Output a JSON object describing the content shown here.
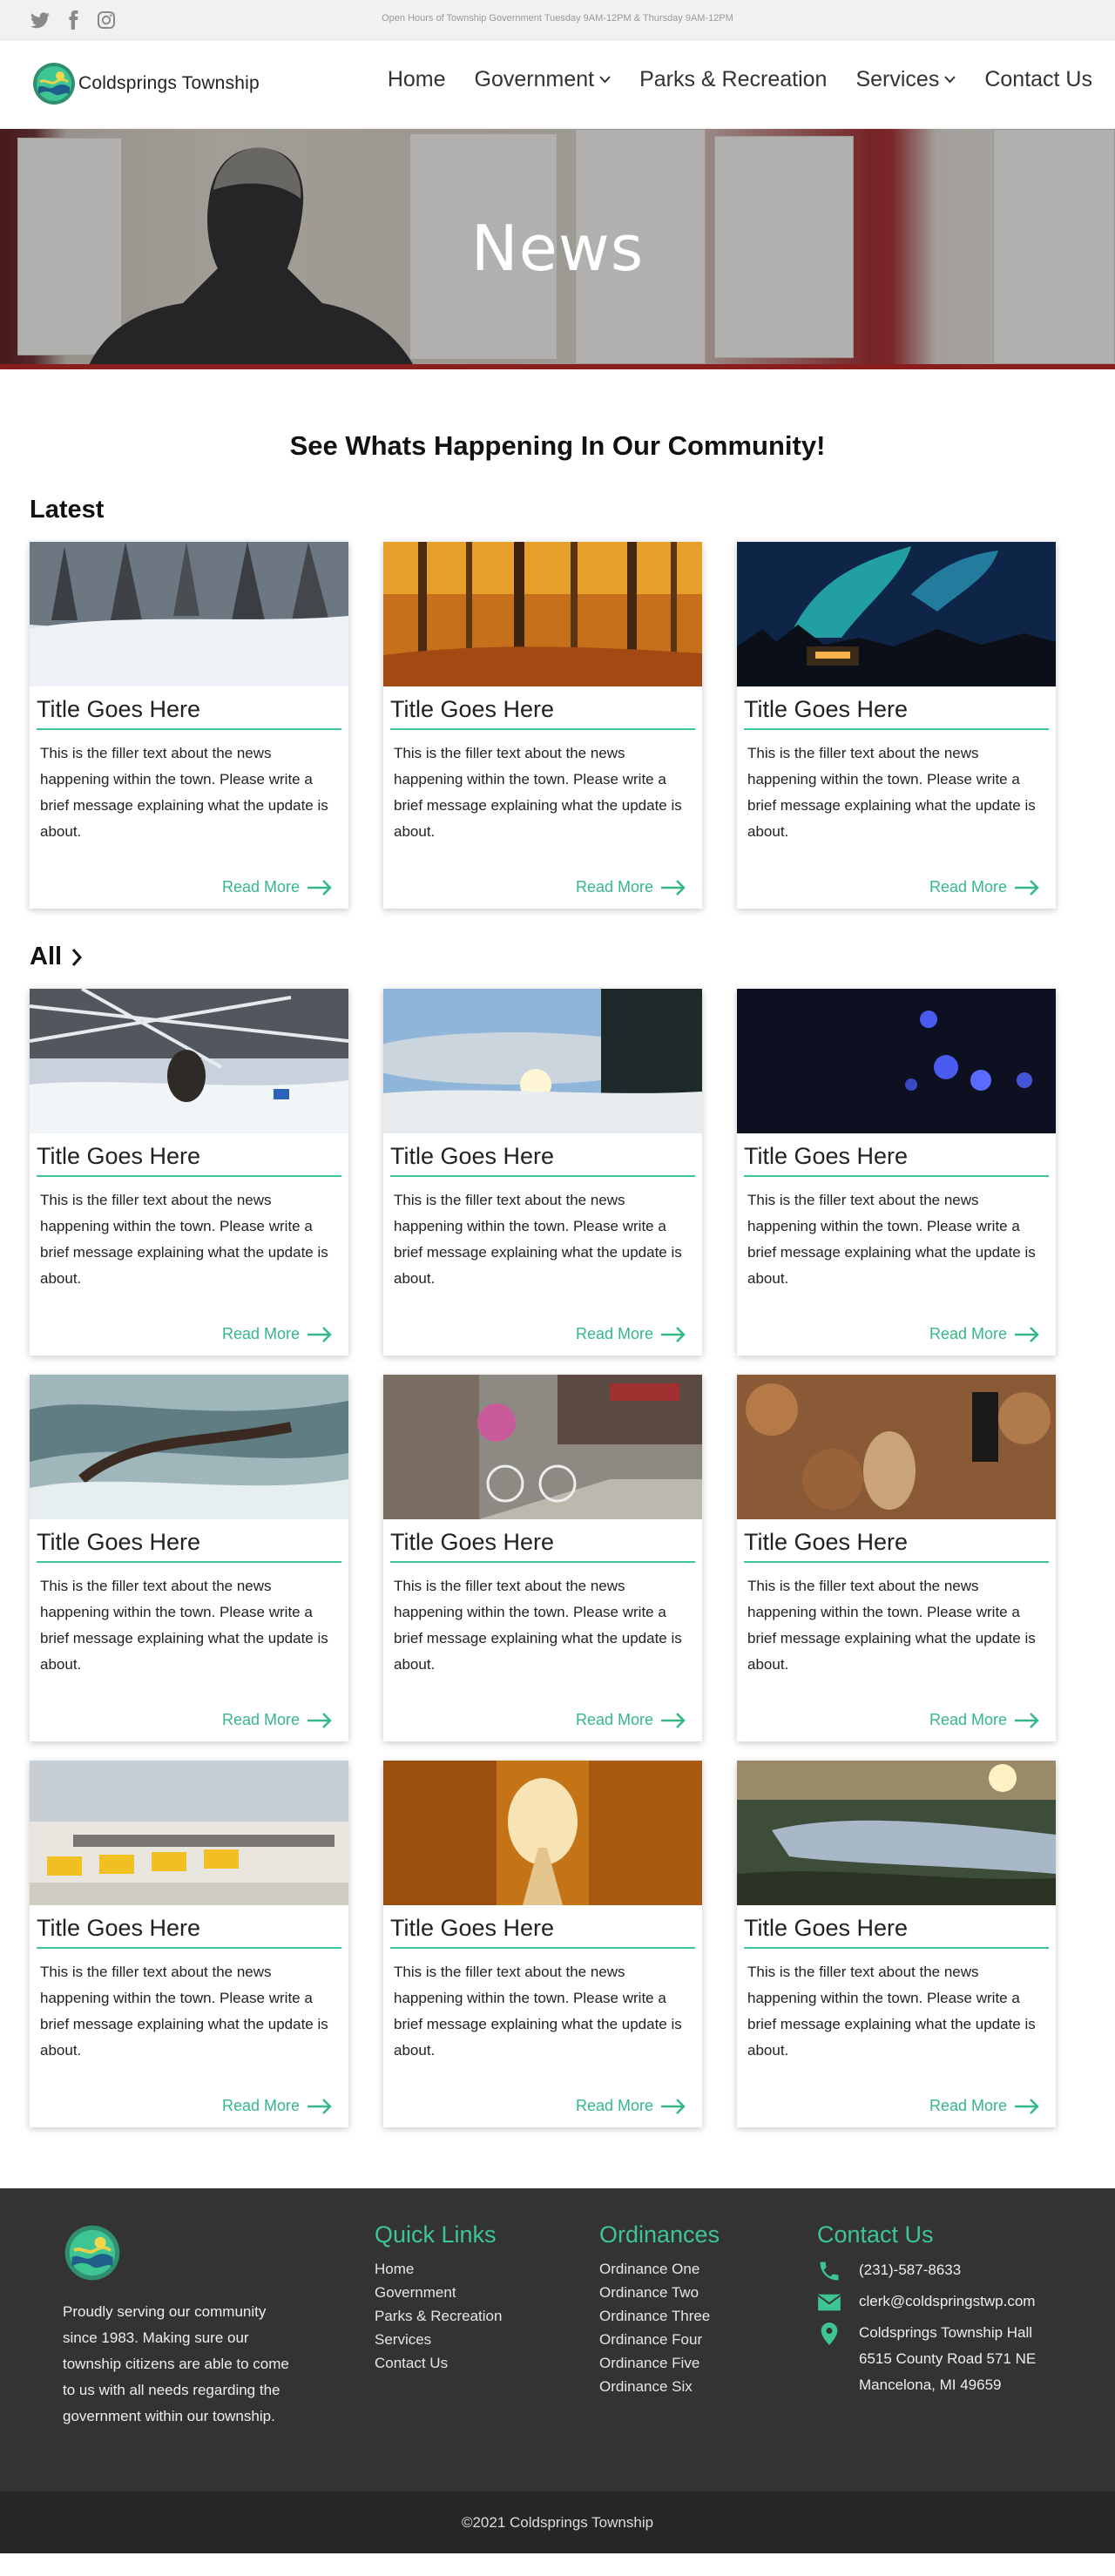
{
  "topbar": {
    "hours": "Open Hours of Township Government Tuesday 9AM-12PM & Thursday 9AM-12PM",
    "social_icons": [
      "twitter-icon",
      "facebook-icon",
      "instagram-icon"
    ]
  },
  "brand": {
    "name": "Coldsprings Township",
    "accent": "#3ec594"
  },
  "nav": {
    "items": [
      {
        "label": "Home"
      },
      {
        "label": "Government"
      },
      {
        "label": "Parks & Recreation"
      },
      {
        "label": "Services"
      },
      {
        "label": "Contact Us"
      }
    ]
  },
  "hero": {
    "title": "News"
  },
  "headline": "See Whats Happening In Our Community!",
  "sections": {
    "latest": "Latest",
    "all": "All"
  },
  "card_defaults": {
    "title": "Title Goes Here",
    "text": "This is the filler text about the news happening within the town. Please write a brief message explaining what the update is about.",
    "read_more": "Read More"
  },
  "latest_cards": [
    {
      "title": "Title Goes Here",
      "text": "This is the filler text about the news happening within the town. Please write a brief message explaining what the update is about.",
      "read_more": "Read More",
      "image": "snowy-forest"
    },
    {
      "title": "Title Goes Here",
      "text": "This is the filler text about the news happening within the town. Please write a brief message explaining what the update is about.",
      "read_more": "Read More",
      "image": "autumn-forest"
    },
    {
      "title": "Title Goes Here",
      "text": "This is the filler text about the news happening within the town. Please write a brief message explaining what the update is about.",
      "read_more": "Read More",
      "image": "northern-lights"
    }
  ],
  "all_cards": [
    {
      "title": "Title Goes Here",
      "text": "This is the filler text about the news happening within the town. Please write a brief message explaining what the update is about.",
      "read_more": "Read More",
      "image": "ice-fishing"
    },
    {
      "title": "Title Goes Here",
      "text": "This is the filler text about the news happening within the town. Please write a brief message explaining what the update is about.",
      "read_more": "Read More",
      "image": "winter-sunset"
    },
    {
      "title": "Title Goes Here",
      "text": "This is the filler text about the news happening within the town. Please write a brief message explaining what the update is about.",
      "read_more": "Read More",
      "image": "jellyfish"
    },
    {
      "title": "Title Goes Here",
      "text": "This is the filler text about the news happening within the town. Please write a brief message explaining what the update is about.",
      "read_more": "Read More",
      "image": "frozen-water"
    },
    {
      "title": "Title Goes Here",
      "text": "This is the filler text about the news happening within the town. Please write a brief message explaining what the update is about.",
      "read_more": "Read More",
      "image": "street-bicycle"
    },
    {
      "title": "Title Goes Here",
      "text": "This is the filler text about the news happening within the town. Please write a brief message explaining what the update is about.",
      "read_more": "Read More",
      "image": "squirrel-leaves"
    },
    {
      "title": "Title Goes Here",
      "text": "This is the filler text about the news happening within the town. Please write a brief message explaining what the update is about.",
      "read_more": "Read More",
      "image": "cafe-chairs"
    },
    {
      "title": "Title Goes Here",
      "text": "This is the filler text about the news happening within the town. Please write a brief message explaining what the update is about.",
      "read_more": "Read More",
      "image": "autumn-road"
    },
    {
      "title": "Title Goes Here",
      "text": "This is the filler text about the news happening within the town. Please write a brief message explaining what the update is about.",
      "read_more": "Read More",
      "image": "lake-sunset"
    }
  ],
  "footer": {
    "about": "Proudly serving our community since 1983. Making sure our township citizens are able to come to us with all needs regarding the government within our township.",
    "quick_links": {
      "title": "Quick Links",
      "items": [
        "Home",
        "Government",
        "Parks & Recreation",
        "Services",
        "Contact Us"
      ]
    },
    "ordinances": {
      "title": "Ordinances",
      "items": [
        "Ordinance One",
        "Ordinance Two",
        "Ordinance Three",
        "Ordinance Four",
        "Ordinance Five",
        "Ordinance Six"
      ]
    },
    "contact": {
      "title": "Contact Us",
      "phone": "(231)-587-8633",
      "email": "clerk@coldspringstwp.com",
      "address_lines": [
        "Coldsprings Township Hall",
        "6515 County Road 571 NE",
        "Mancelona, MI 49659"
      ]
    },
    "copyright": "©2021 Coldsprings Township"
  }
}
